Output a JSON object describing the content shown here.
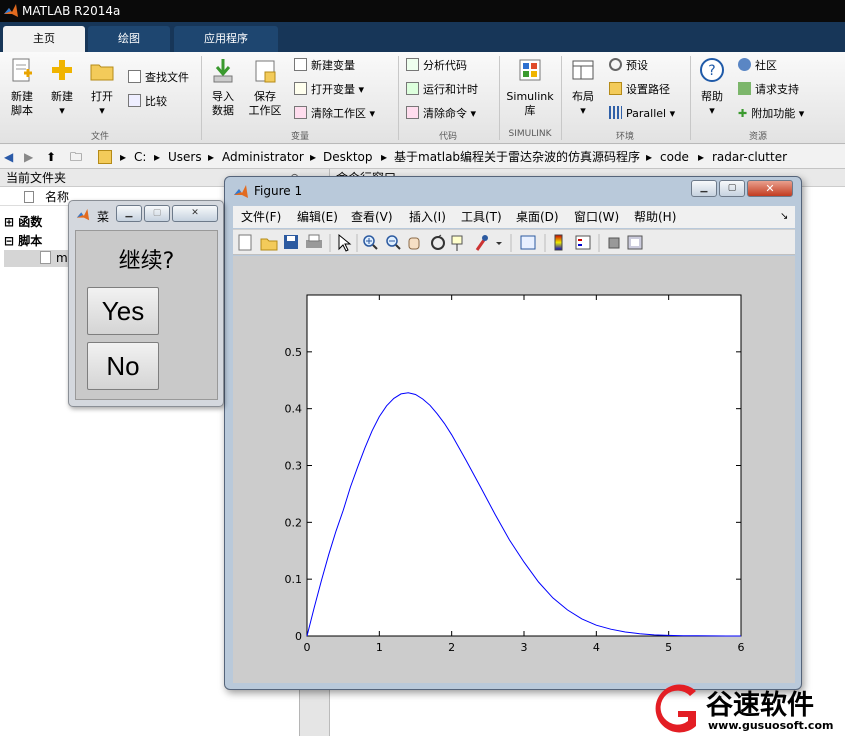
{
  "window": {
    "title": "MATLAB R2014a"
  },
  "tabs": [
    {
      "label": "主页"
    },
    {
      "label": "绘图"
    },
    {
      "label": "应用程序"
    }
  ],
  "ribbon": {
    "file": {
      "new_script": [
        "新建",
        "脚本"
      ],
      "new": "新建",
      "open": "打开",
      "find_files": "查找文件",
      "compare": "比较",
      "group": "文件"
    },
    "variable": {
      "import": [
        "导入",
        "数据"
      ],
      "save": [
        "保存",
        "工作区"
      ],
      "new_var": "新建变量",
      "open_var": "打开变量",
      "clear_ws": "清除工作区",
      "group": "变量"
    },
    "code": {
      "analyze": "分析代码",
      "run_time": "运行和计时",
      "clear_cmd": "清除命令",
      "group": "代码"
    },
    "simulink": {
      "label": [
        "Simulink",
        "库"
      ],
      "group": "SIMULINK"
    },
    "env": {
      "layout": "布局",
      "prefs": "预设",
      "set_path": "设置路径",
      "parallel": "Parallel",
      "group": "环境"
    },
    "resources": {
      "help": "帮助",
      "community": "社区",
      "support": "请求支持",
      "addons": "附加功能",
      "group": "资源"
    }
  },
  "address": {
    "parts": [
      "C:",
      "Users",
      "Administrator",
      "Desktop",
      "基于matlab编程关于雷达杂波的仿真源码程序",
      "code",
      "radar-clutter"
    ]
  },
  "current_folder": {
    "title": "当前文件夹",
    "name_col": "名称",
    "groups": [
      "函数",
      "脚本"
    ],
    "file_prefix": "m"
  },
  "command_window": {
    "title": "命令行窗口"
  },
  "dialog": {
    "title": "菜",
    "question": "继续?",
    "yes": "Yes",
    "no": "No"
  },
  "figure": {
    "title": "Figure 1",
    "menu": [
      "文件(F)",
      "编辑(E)",
      "查看(V)",
      "插入(I)",
      "工具(T)",
      "桌面(D)",
      "窗口(W)",
      "帮助(H)"
    ]
  },
  "chart_data": {
    "type": "line",
    "title": "",
    "xlabel": "",
    "ylabel": "",
    "xlim": [
      0,
      6
    ],
    "ylim": [
      0,
      0.6
    ],
    "xticks": [
      0,
      1,
      2,
      3,
      4,
      5,
      6
    ],
    "yticks": [
      0,
      0.1,
      0.2,
      0.3,
      0.4,
      0.5
    ],
    "grid": false,
    "series": [
      {
        "color": "#0000ff",
        "x": [
          0,
          0.1,
          0.2,
          0.3,
          0.4,
          0.5,
          0.6,
          0.7,
          0.8,
          0.9,
          1.0,
          1.1,
          1.2,
          1.3,
          1.4,
          1.5,
          1.6,
          1.7,
          1.8,
          1.9,
          2.0,
          2.2,
          2.4,
          2.6,
          2.8,
          3.0,
          3.2,
          3.4,
          3.6,
          3.8,
          4.0,
          4.2,
          4.4,
          4.6,
          4.8,
          5.0,
          5.2,
          5.4,
          5.6,
          5.8,
          6.0
        ],
        "y": [
          0,
          0.05,
          0.098,
          0.143,
          0.184,
          0.221,
          0.262,
          0.297,
          0.331,
          0.361,
          0.386,
          0.405,
          0.418,
          0.426,
          0.428,
          0.425,
          0.417,
          0.406,
          0.391,
          0.374,
          0.354,
          0.309,
          0.262,
          0.214,
          0.169,
          0.13,
          0.095,
          0.067,
          0.046,
          0.03,
          0.019,
          0.012,
          0.007,
          0.004,
          0.002,
          0.001,
          0.0006,
          0.0003,
          0.0001,
          0,
          0
        ]
      }
    ]
  },
  "watermark": {
    "brand": "谷速软件",
    "url": "www.gusuosoft.com"
  },
  "colors": {
    "accent": "#173658",
    "tab": "#1e4670",
    "line": "#0000ff",
    "watermark": "#e31e24"
  }
}
